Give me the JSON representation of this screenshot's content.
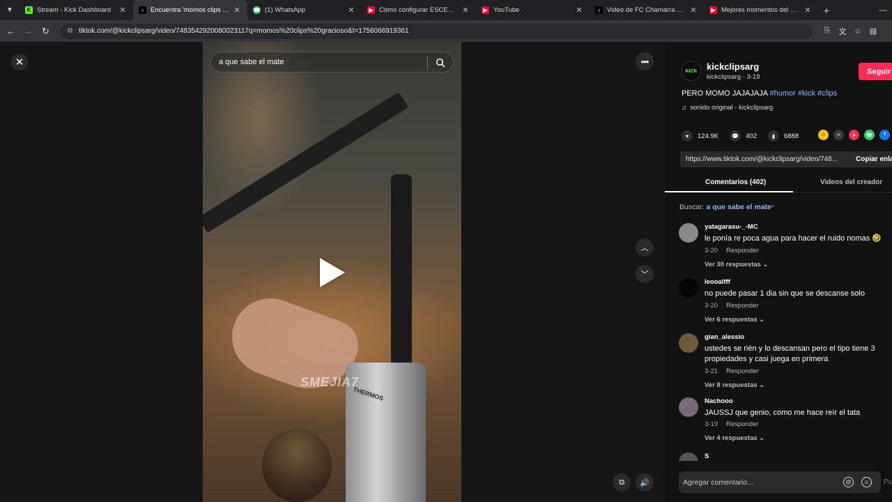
{
  "tabs": [
    {
      "title": "Stream - Kick Dashboard",
      "favicon": "kick-icon",
      "color": "#53fc18",
      "active": false
    },
    {
      "title": "Encuentra 'momos clips gracio",
      "favicon": "tiktok-icon",
      "color": "#ffffff",
      "active": true
    },
    {
      "title": "(1) WhatsApp",
      "favicon": "whatsapp-icon",
      "color": "#25d366",
      "active": false
    },
    {
      "title": "Cómo configurar ESCENAS y F",
      "favicon": "youtube-icon",
      "color": "#ff0033",
      "active": false
    },
    {
      "title": "YouTube",
      "favicon": "youtube-icon",
      "color": "#ff0033",
      "active": false
    },
    {
      "title": "Video de FC Chamarra El (@elc",
      "favicon": "tiktok-icon",
      "color": "#ffffff",
      "active": false
    },
    {
      "title": "Mejores momentos del Momo (",
      "favicon": "youtube-icon",
      "color": "#ff0033",
      "active": false
    }
  ],
  "toolbar": {
    "url": "tiktok.com/@kickclipsarg/video/7483542920080023117q=momos%20clips%20gracioso&t=1756066919361"
  },
  "video": {
    "search_value": "a que sabe el mate",
    "watermark": "SMEJIA7",
    "thermos_label": "THERMOS"
  },
  "panel": {
    "creator_name": "kickclipsarg",
    "creator_sub": "kickclipsarg · 3-19",
    "avatar_text": "KICK",
    "follow_label": "Seguir",
    "caption_text": "PERO MOMO JAJAJAJA ",
    "caption_tags": "#humor #kick #clips",
    "sound": "sonido original - kickclipsarg",
    "likes": "124.9K",
    "comments_count": "402",
    "saves": "6888",
    "link": "https://www.tiktok.com/@kickclipsarg/video/748...",
    "copy_label": "Copiar enlace",
    "tab_comments": "Comentarios (402)",
    "tab_creator_videos": "Videos del creador",
    "search_prefix": "Buscar: ",
    "search_query": "a que sabe el mate",
    "add_comment_placeholder": "Agregar comentario...",
    "post_label": "Pu"
  },
  "comments": [
    {
      "user": "yatagarasu-_-MC",
      "text": "le ponía re poca agua para hacer el ruido nomas 🤣",
      "date": "3-20",
      "reply": "Responder",
      "more": "Ver 30 respuestas ⌄",
      "avatar_color": "#8a8a8a"
    },
    {
      "user": "leooalfff",
      "text": "no puede pasar 1 dia sin que se descanse solo",
      "date": "3-20",
      "reply": "Responder",
      "more": "Ver 6 respuestas ⌄",
      "avatar_color": "#050505"
    },
    {
      "user": "gian_alessio",
      "text": "ustedes se rién y lo descansan pero el tipo tiene 3 propiedades y casi juega en primera",
      "date": "3-21",
      "reply": "Responder",
      "more": "Ver 8 respuestas ⌄",
      "avatar_color": "#6b5a3e"
    },
    {
      "user": "Nachooo",
      "text": "JAUSSJ que genio, como me hace reír el tata",
      "date": "3-19",
      "reply": "Responder",
      "more": "Ver 4 respuestas ⌄",
      "avatar_color": "#7a6a78"
    },
    {
      "user": "S",
      "text": "",
      "date": "",
      "reply": "",
      "more": "",
      "avatar_color": "#555555"
    }
  ]
}
